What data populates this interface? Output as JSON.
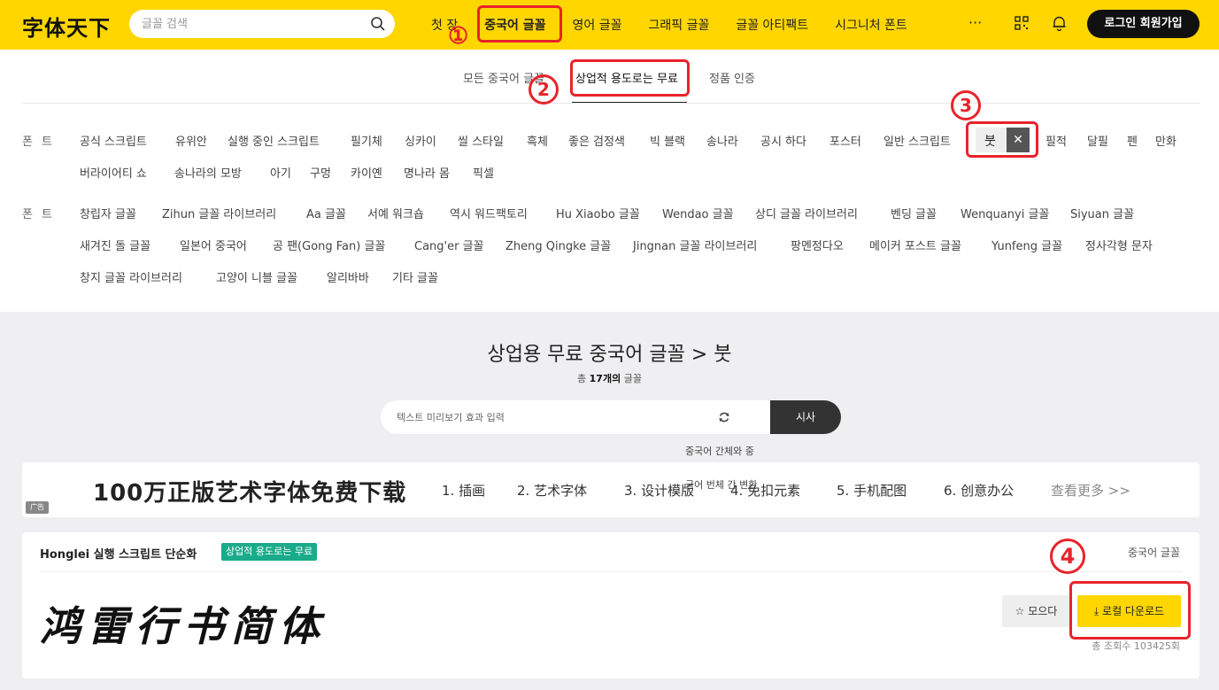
{
  "header": {
    "logo": "字体天下",
    "search_placeholder": "글꼴 검색",
    "nav": [
      "첫 장",
      "중국어 글꼴",
      "영어 글꼴",
      "그래픽 글꼴",
      "글꼴 아티팩트",
      "시그니처 폰트"
    ],
    "more": "···",
    "login": "로그인 회원가입"
  },
  "annotations": {
    "n1": "①",
    "n2": "2",
    "n3": "3",
    "n4": "4"
  },
  "subtabs": [
    "모든 중국어 글꼴",
    "상업적 용도로는 무료",
    "정품 인증"
  ],
  "filters": {
    "label1": "폰트",
    "row1": [
      "공식 스크립트",
      "유위안",
      "실행 중인 스크립트",
      "필기체",
      "싱카이",
      "씰 스타일",
      "흑체",
      "좋은 검정색",
      "빅 블랙",
      "송나라",
      "공시 하다",
      "포스터",
      "일반 스크립트"
    ],
    "selected": "붓",
    "row1_after": [
      "필적",
      "달필",
      "펜",
      "만화"
    ],
    "row2": [
      "버라이어티 쇼",
      "송나라의 모방",
      "아기",
      "구멍",
      "카이옌",
      "명나라 몸",
      "픽셀"
    ],
    "label2": "폰트",
    "row3": [
      "창립자 글꼴",
      "Zihun 글꼴 라이브러리",
      "Aa 글꼴",
      "서예 워크숍",
      "역시 워드팩토리",
      "Hu Xiaobo 글꼴",
      "Wendao 글꼴",
      "상디 글꼴 라이브러리",
      "벤딩 글꼴",
      "Wenquanyi 글꼴",
      "Siyuan 글꼴"
    ],
    "row4": [
      "새겨진 돌 글꼴",
      "일본어 중국어",
      "공 팬(Gong Fan) 글꼴",
      "Cang'er 글꼴",
      "Zheng Qingke 글꼴",
      "Jingnan 글꼴 라이브러리",
      "팡멘정다오",
      "메이커 포스트 글꼴",
      "Yunfeng 글꼴",
      "정사각형 문자"
    ],
    "row5": [
      "창지 글꼴 라이브러리",
      "고양이 니블 글꼴",
      "알리바바",
      "기타 글꼴"
    ]
  },
  "result": {
    "title": "상업용 무료 중국어 글꼴 > 붓",
    "count_prefix": "총",
    "count_value": "17개의",
    "count_suffix": "글꼴",
    "preview_placeholder": "텍스트 미리보기 효과 입력",
    "preview_button": "시사",
    "convert1": "중국어 간체와 중",
    "convert2": "국어 번체 간 변환"
  },
  "ad": {
    "title": "100万正版艺术字体免费下载",
    "links": [
      "1. 插画",
      "2. 艺术字体",
      "3. 设计模版",
      "4. 免扣元素",
      "5. 手机配图",
      "6. 创意办公"
    ],
    "more": "查看更多 >>",
    "badge": "广告"
  },
  "card": {
    "name": "Honglei 실행 스크립트 단순화",
    "badge": "상업적 용도로는 무료",
    "category": "중국어 글꼴",
    "preview": "鸿雷行书简体",
    "collect": "☆ 모으다",
    "download": "⤓ 로컬 다운로드",
    "views": "총 조회수 103425회"
  },
  "colors": {
    "brand_yellow": "#ffd600",
    "annotation_red": "#e8232b",
    "badge_green": "#1aab8a"
  }
}
